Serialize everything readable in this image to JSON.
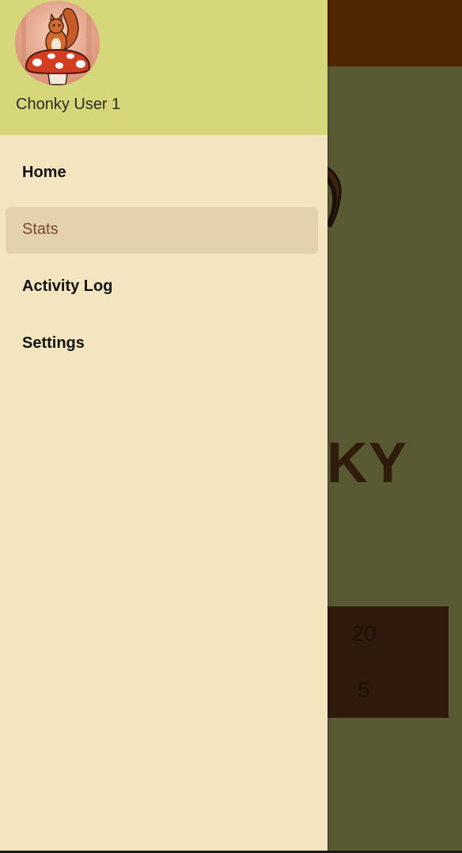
{
  "background": {
    "title_fragment": "IKY",
    "stats_values": [
      "20",
      "5"
    ]
  },
  "drawer": {
    "user_name": "Chonky User 1",
    "avatar_icon": "squirrel-on-mushroom-avatar",
    "items": [
      {
        "label": "Home",
        "active": false
      },
      {
        "label": "Stats",
        "active": true
      },
      {
        "label": "Activity Log",
        "active": false
      },
      {
        "label": "Settings",
        "active": false
      }
    ]
  },
  "colors": {
    "drawer_bg": "#f2e5bf",
    "header_bg": "#d5d77a",
    "active_item_bg": "#e3d2ac",
    "active_item_text": "#7b4a2b",
    "topbar": "#502700",
    "scrim_content": "#595a33"
  }
}
